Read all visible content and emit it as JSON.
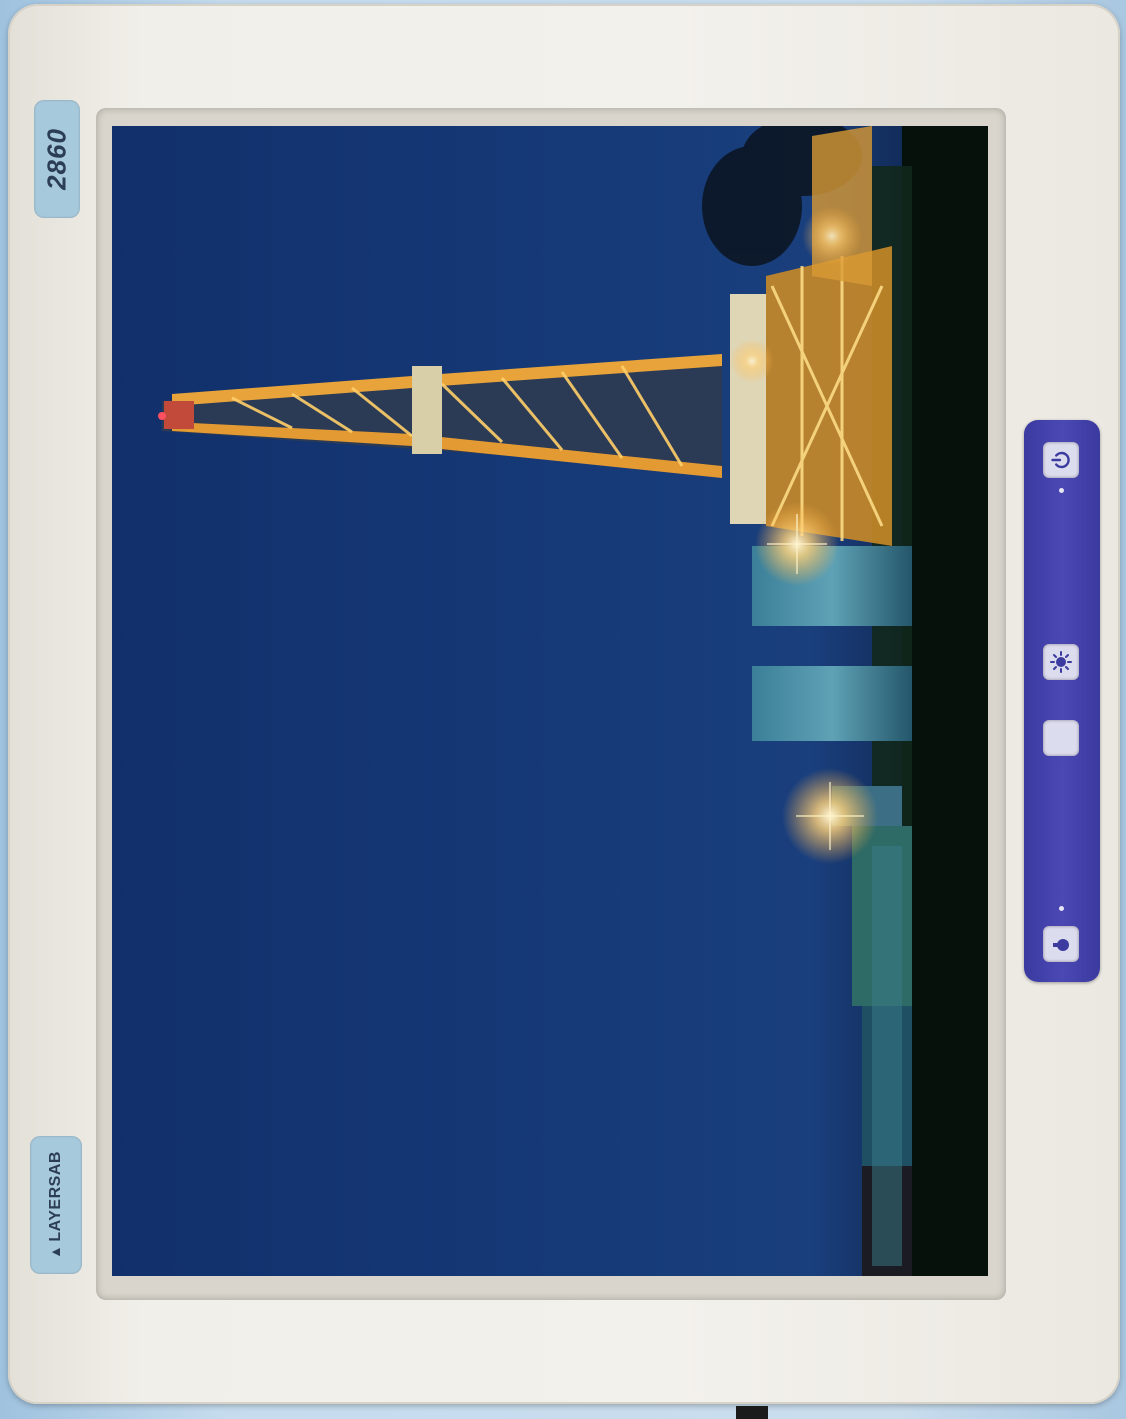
{
  "device": {
    "model_label": "2860",
    "brand_label": "LAYERSAB"
  },
  "control_panel": {
    "buttons": [
      {
        "id": "power",
        "icon": "power-icon"
      },
      {
        "id": "brightness",
        "icon": "sun-icon"
      },
      {
        "id": "night-mode",
        "icon": "moon-icon"
      },
      {
        "id": "input-source",
        "icon": "source-icon"
      }
    ]
  },
  "colors": {
    "bezel": "#f1efe9",
    "badge": "#a7c9dc",
    "panel": "#4342ab",
    "sky": "#11306b",
    "rig_light": "#f5b83a"
  }
}
